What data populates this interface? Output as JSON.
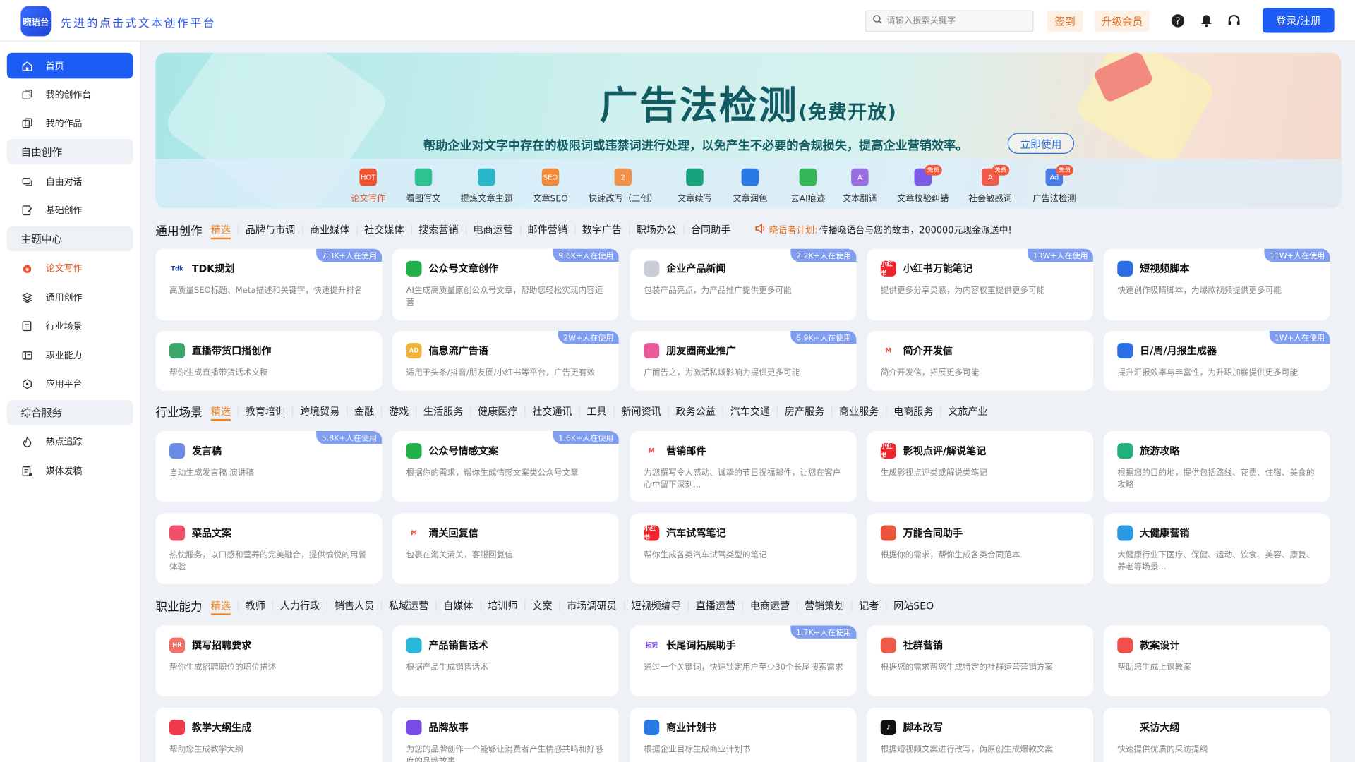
{
  "header": {
    "logo_text": "晓语台",
    "slogan": "先进的点击式文本创作平台",
    "search_placeholder": "请输入搜索关键字",
    "signin": "签到",
    "upgrade": "升级会员",
    "login": "登录/注册"
  },
  "sidebar": {
    "items": [
      {
        "label": "首页"
      },
      {
        "label": "我的创作台"
      },
      {
        "label": "我的作品"
      },
      {
        "group": "自由创作"
      },
      {
        "label": "自由对话"
      },
      {
        "label": "基础创作"
      },
      {
        "group": "主题中心"
      },
      {
        "label": "论文写作"
      },
      {
        "label": "通用创作"
      },
      {
        "label": "行业场景"
      },
      {
        "label": "职业能力"
      },
      {
        "label": "应用平台"
      },
      {
        "group": "综合服务"
      },
      {
        "label": "热点追踪"
      },
      {
        "label": "媒体发稿"
      }
    ]
  },
  "banner": {
    "title": "广告法检测",
    "title_suffix": "(免费开放)",
    "subtitle": "帮助企业对文字中存在的极限词或违禁词进行处理，以免产生不必要的合规损失，提高企业营销效率。",
    "cta": "立即使用",
    "tools": [
      {
        "label": "论文写作",
        "icon_text": "HOT",
        "color": "#f0512e"
      },
      {
        "label": "看图写文",
        "icon_text": "",
        "color": "#2fc28f"
      },
      {
        "label": "提炼文章主题",
        "icon_text": "",
        "color": "#28b7c9"
      },
      {
        "label": "文章SEO",
        "icon_text": "SEO",
        "color": "#f08a3a"
      },
      {
        "label": "快速改写（二创）",
        "icon_text": "2",
        "color": "#f0914a"
      },
      {
        "label": "文章续写",
        "icon_text": "",
        "color": "#16a37c"
      },
      {
        "label": "文章润色",
        "icon_text": "",
        "color": "#2a7ae6"
      },
      {
        "label": "去AI痕迹",
        "icon_text": "",
        "color": "#34b556"
      },
      {
        "label": "文本翻译",
        "icon_text": "A",
        "color": "#9a6de0"
      },
      {
        "label": "文章校验纠错",
        "icon_text": "",
        "color": "#7b5ae8",
        "badge": "免费"
      },
      {
        "label": "社会敏感词",
        "icon_text": "A",
        "color": "#ef5a4a",
        "badge": "免费"
      },
      {
        "label": "广告法检测",
        "icon_text": "Ad",
        "color": "#4a7ae8",
        "badge": "免费"
      }
    ]
  },
  "announce": {
    "name": "晓语者计划:",
    "text": "传播晓语台与您的故事，200000元现金派送中!"
  },
  "sections": [
    {
      "title": "通用创作",
      "chips": [
        "精选",
        "品牌与市调",
        "商业媒体",
        "社交媒体",
        "搜索营销",
        "电商运营",
        "邮件营销",
        "数字广告",
        "职场办公",
        "合同助手"
      ],
      "cards": [
        {
          "title": "TDK规划",
          "desc": "高质量SEO标题、Meta描述和关键字，快速提升排名",
          "usage": "7.3K+人在使用",
          "icon_text": "Tdk",
          "color": "#ffffff",
          "icon_fg": "#1b3fb0"
        },
        {
          "title": "公众号文章创作",
          "desc": "AI生成高质量原创公众号文章，帮助您轻松实现内容运营",
          "usage": "9.6K+人在使用",
          "icon_text": "",
          "color": "#22b04a"
        },
        {
          "title": "企业产品新闻",
          "desc": "包装产品亮点，为产品推广提供更多可能",
          "usage": "2.2K+人在使用",
          "icon_text": "",
          "color": "#c8ccd4"
        },
        {
          "title": "小红书万能笔记",
          "desc": "提供更多分享灵感，为内容权重提供更多可能",
          "usage": "13W+人在使用",
          "icon_text": "小红书",
          "color": "#f0242e"
        },
        {
          "title": "短视频脚本",
          "desc": "快速创作吸睛脚本，为爆款视频提供更多可能",
          "usage": "11W+人在使用",
          "icon_text": "",
          "color": "#2a6fe6"
        },
        {
          "title": "直播带货口播创作",
          "desc": "帮你生成直播带货话术文稿",
          "usage": "",
          "icon_text": "",
          "color": "#3aa66a"
        },
        {
          "title": "信息流广告语",
          "desc": "适用于头条/抖音/朋友圈/小红书等平台，广告更有效",
          "usage": "2W+人在使用",
          "icon_text": "AD",
          "color": "#f0b33a"
        },
        {
          "title": "朋友圈商业推广",
          "desc": "广而告之，为激活私域影响力提供更多可能",
          "usage": "6.9K+人在使用",
          "icon_text": "",
          "color": "#e85a9a"
        },
        {
          "title": "简介开发信",
          "desc": "简介开发信，拓展更多可能",
          "usage": "",
          "icon_text": "M",
          "color": "#ffffff",
          "icon_fg": "#e8453c"
        },
        {
          "title": "日/周/月报生成器",
          "desc": "提升汇报效率与丰富性，为升职加薪提供更多可能",
          "usage": "1W+人在使用",
          "icon_text": "",
          "color": "#2a6fe6"
        }
      ]
    },
    {
      "title": "行业场景",
      "chips": [
        "精选",
        "教育培训",
        "跨境贸易",
        "金融",
        "游戏",
        "生活服务",
        "健康医疗",
        "社交通讯",
        "工具",
        "新闻资讯",
        "政务公益",
        "汽车交通",
        "房产服务",
        "商业服务",
        "电商服务",
        "文旅产业"
      ],
      "cards": [
        {
          "title": "发言稿",
          "desc": "自动生成发言稿 演讲稿",
          "usage": "5.8K+人在使用",
          "icon_text": "",
          "color": "#6a8ae6"
        },
        {
          "title": "公众号情感文案",
          "desc": "根据你的需求，帮你生成情感文案类公众号文章",
          "usage": "1.6K+人在使用",
          "icon_text": "",
          "color": "#22b04a"
        },
        {
          "title": "营销邮件",
          "desc": "为您撰写令人感动、诚挚的节日祝福邮件，让您在客户心中留下深刻...",
          "usage": "",
          "icon_text": "M",
          "color": "#ffffff",
          "icon_fg": "#e8453c"
        },
        {
          "title": "影视点评/解说笔记",
          "desc": "生成影视点评类或解说类笔记",
          "usage": "",
          "icon_text": "小红书",
          "color": "#f0242e"
        },
        {
          "title": "旅游攻略",
          "desc": "根据您的目的地，提供包括路线、花费、住宿、美食的攻略",
          "usage": "",
          "icon_text": "",
          "color": "#22b07a"
        },
        {
          "title": "菜品文案",
          "desc": "热忱服务，以口感和营养的完美融合，提供愉悦的用餐体验",
          "usage": "",
          "icon_text": "",
          "color": "#f0506a"
        },
        {
          "title": "清关回复信",
          "desc": "包裹在海关清关，客服回复信",
          "usage": "",
          "icon_text": "M",
          "color": "#ffffff",
          "icon_fg": "#e8453c"
        },
        {
          "title": "汽车试驾笔记",
          "desc": "帮你生成各类汽车试驾类型的笔记",
          "usage": "",
          "icon_text": "小红书",
          "color": "#f0242e"
        },
        {
          "title": "万能合同助手",
          "desc": "根据你的需求，帮你生成各类合同范本",
          "usage": "",
          "icon_text": "",
          "color": "#e8553a"
        },
        {
          "title": "大健康营销",
          "desc": "大健康行业下医疗、保健、运动、饮食、美容、康复、养老等场景...",
          "usage": "",
          "icon_text": "",
          "color": "#2a9ae6"
        }
      ]
    },
    {
      "title": "职业能力",
      "chips": [
        "精选",
        "教师",
        "人力行政",
        "销售人员",
        "私域运营",
        "自媒体",
        "培训师",
        "文案",
        "市场调研员",
        "短视频编导",
        "直播运营",
        "电商运营",
        "营销策划",
        "记者",
        "网站SEO"
      ],
      "cards": [
        {
          "title": "撰写招聘要求",
          "desc": "帮你生成招聘职位的职位描述",
          "usage": "",
          "icon_text": "HR",
          "color": "#f0706a"
        },
        {
          "title": "产品销售话术",
          "desc": "根据产品生成销售话术",
          "usage": "",
          "icon_text": "",
          "color": "#28b7d9"
        },
        {
          "title": "长尾词拓展助手",
          "desc": "通过一个关键词，快速锁定用户至少30个长尾搜索需求",
          "usage": "1.7K+人在使用",
          "icon_text": "拓词",
          "color": "#ffffff",
          "icon_fg": "#7a3ae6"
        },
        {
          "title": "社群营销",
          "desc": "根据您的需求帮您生成特定的社群运营营销方案",
          "usage": "",
          "icon_text": "",
          "color": "#f05a4a"
        },
        {
          "title": "教案设计",
          "desc": "帮助您生成上课教案",
          "usage": "",
          "icon_text": "",
          "color": "#f0504a"
        },
        {
          "title": "教学大纲生成",
          "desc": "帮助您生成教学大纲",
          "usage": "",
          "icon_text": "",
          "color": "#f03a4a"
        },
        {
          "title": "品牌故事",
          "desc": "为您的品牌创作一个能够让消费者产生情感共鸣和好感度的品牌故事",
          "usage": "",
          "icon_text": "",
          "color": "#7a4ae6"
        },
        {
          "title": "商业计划书",
          "desc": "根据企业目标生成商业计划书",
          "usage": "",
          "icon_text": "",
          "color": "#2a7ae6"
        },
        {
          "title": "脚本改写",
          "desc": "根据短视频文案进行改写，伪原创生成爆款文案",
          "usage": "",
          "icon_text": "♪",
          "color": "#111111"
        },
        {
          "title": "采访大纲",
          "desc": "快速提供优质的采访提纲",
          "usage": "",
          "icon_text": "",
          "color": "#ffffff",
          "icon_fg": "#2a6fe6"
        }
      ]
    }
  ]
}
